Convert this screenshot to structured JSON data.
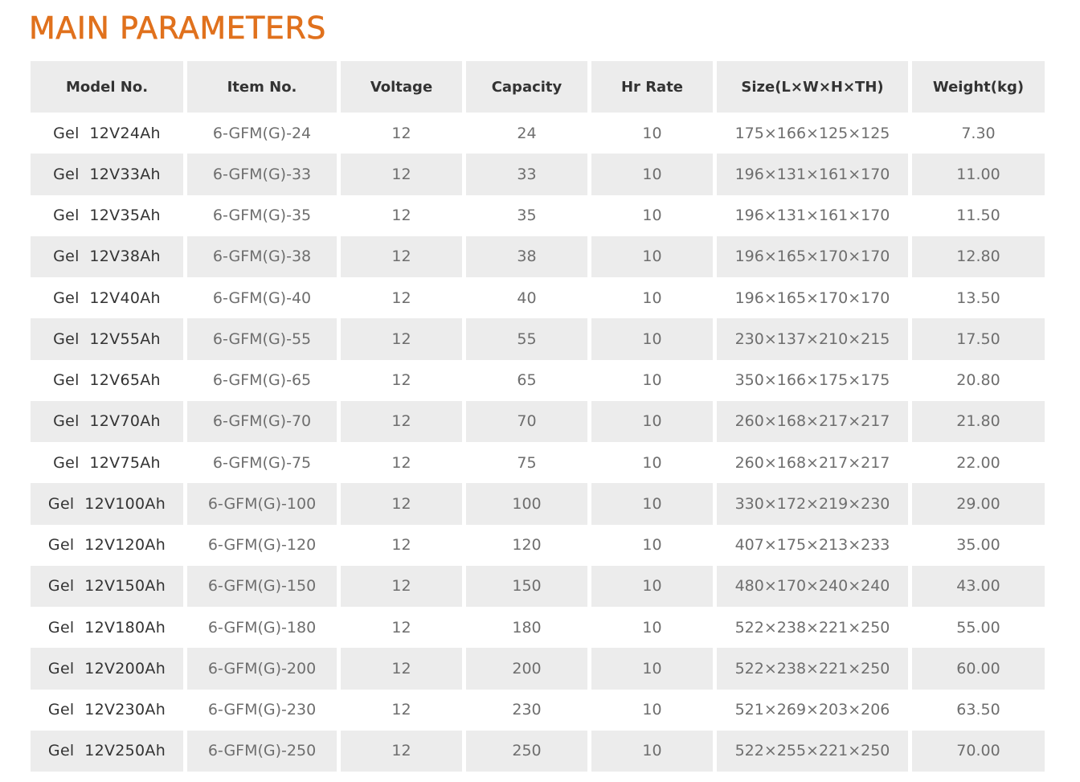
{
  "title": "MAIN PARAMETERS",
  "colors": {
    "title": "#e0711d",
    "header_bg": "#ececec",
    "row_alt_bg": "#ececec",
    "text": "#6e6e6e",
    "header_text": "#333333"
  },
  "table": {
    "headers": [
      "Model No.",
      "Item No.",
      "Voltage",
      "Capacity",
      "Hr Rate",
      "Size(L×W×H×TH)",
      "Weight(kg)"
    ],
    "rows": [
      [
        "Gel  12V24Ah",
        "6-GFM(G)-24",
        "12",
        "24",
        "10",
        "175×166×125×125",
        "7.30"
      ],
      [
        "Gel  12V33Ah",
        "6-GFM(G)-33",
        "12",
        "33",
        "10",
        "196×131×161×170",
        "11.00"
      ],
      [
        "Gel  12V35Ah",
        "6-GFM(G)-35",
        "12",
        "35",
        "10",
        "196×131×161×170",
        "11.50"
      ],
      [
        "Gel  12V38Ah",
        "6-GFM(G)-38",
        "12",
        "38",
        "10",
        "196×165×170×170",
        "12.80"
      ],
      [
        "Gel  12V40Ah",
        "6-GFM(G)-40",
        "12",
        "40",
        "10",
        "196×165×170×170",
        "13.50"
      ],
      [
        "Gel  12V55Ah",
        "6-GFM(G)-55",
        "12",
        "55",
        "10",
        "230×137×210×215",
        "17.50"
      ],
      [
        "Gel  12V65Ah",
        "6-GFM(G)-65",
        "12",
        "65",
        "10",
        "350×166×175×175",
        "20.80"
      ],
      [
        "Gel  12V70Ah",
        "6-GFM(G)-70",
        "12",
        "70",
        "10",
        "260×168×217×217",
        "21.80"
      ],
      [
        "Gel  12V75Ah",
        "6-GFM(G)-75",
        "12",
        "75",
        "10",
        "260×168×217×217",
        "22.00"
      ],
      [
        "Gel  12V100Ah",
        "6-GFM(G)-100",
        "12",
        "100",
        "10",
        "330×172×219×230",
        "29.00"
      ],
      [
        "Gel  12V120Ah",
        "6-GFM(G)-120",
        "12",
        "120",
        "10",
        "407×175×213×233",
        "35.00"
      ],
      [
        "Gel  12V150Ah",
        "6-GFM(G)-150",
        "12",
        "150",
        "10",
        "480×170×240×240",
        "43.00"
      ],
      [
        "Gel  12V180Ah",
        "6-GFM(G)-180",
        "12",
        "180",
        "10",
        "522×238×221×250",
        "55.00"
      ],
      [
        "Gel  12V200Ah",
        "6-GFM(G)-200",
        "12",
        "200",
        "10",
        "522×238×221×250",
        "60.00"
      ],
      [
        "Gel  12V230Ah",
        "6-GFM(G)-230",
        "12",
        "230",
        "10",
        "521×269×203×206",
        "63.50"
      ],
      [
        "Gel  12V250Ah",
        "6-GFM(G)-250",
        "12",
        "250",
        "10",
        "522×255×221×250",
        "70.00"
      ]
    ]
  }
}
